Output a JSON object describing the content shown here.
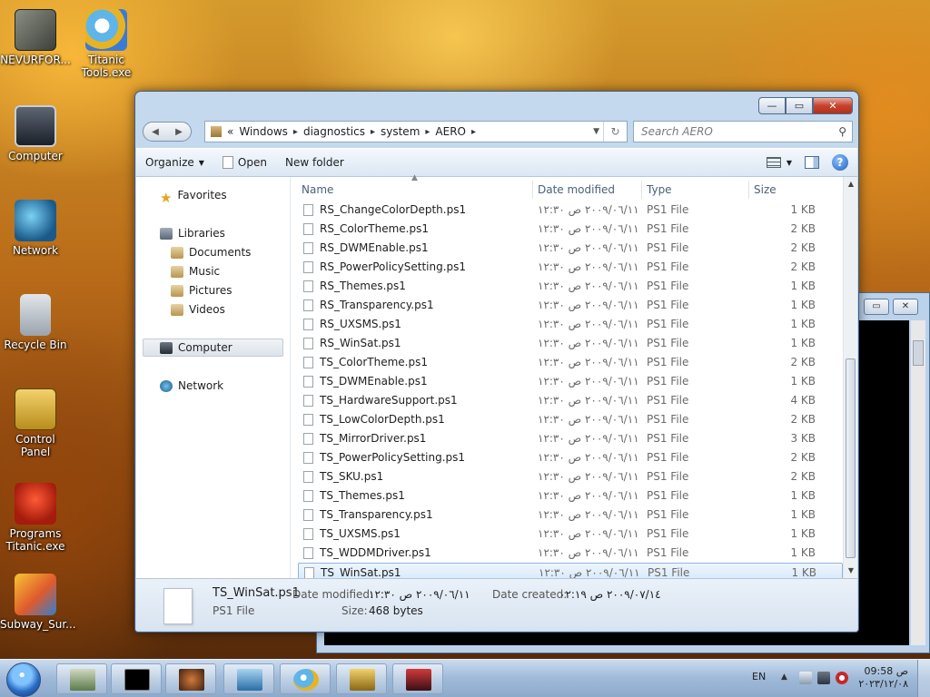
{
  "desktop": {
    "icons": [
      {
        "label": "NEVURFOR...",
        "icon": "nevurfor-icon"
      },
      {
        "label": "Titanic\nTools.exe",
        "icon": "titanic-tools-icon"
      },
      {
        "label": "Computer",
        "icon": "computer-icon"
      },
      {
        "label": "Network",
        "icon": "network-icon"
      },
      {
        "label": "Recycle Bin",
        "icon": "recycle-bin-icon"
      },
      {
        "label": "Control Panel",
        "icon": "control-panel-icon"
      },
      {
        "label": "Programs\nTitanic.exe",
        "icon": "programs-titanic-icon"
      },
      {
        "label": "Subway_Sur...",
        "icon": "subway-surfers-icon"
      }
    ]
  },
  "explorer": {
    "window_buttons": {
      "minimize": "—",
      "maximize": "▭",
      "close": "✕"
    },
    "breadcrumb": {
      "overflow": "«",
      "parts": [
        "Windows",
        "diagnostics",
        "system",
        "AERO"
      ]
    },
    "search": {
      "placeholder": "Search AERO"
    },
    "toolbar": {
      "organize": "Organize",
      "open": "Open",
      "new_folder": "New folder"
    },
    "nav": {
      "favorites": "Favorites",
      "libraries": "Libraries",
      "documents": "Documents",
      "music": "Music",
      "pictures": "Pictures",
      "videos": "Videos",
      "computer": "Computer",
      "network": "Network"
    },
    "columns": {
      "name": "Name",
      "date_modified": "Date modified",
      "type": "Type",
      "size": "Size"
    },
    "files": [
      {
        "name": "RS_ChangeColorDepth.ps1",
        "date": "٢٠٠٩/٠٦/١١ ص ١٢:٣٠",
        "type": "PS1 File",
        "size": "1 KB"
      },
      {
        "name": "RS_ColorTheme.ps1",
        "date": "٢٠٠٩/٠٦/١١ ص ١٢:٣٠",
        "type": "PS1 File",
        "size": "2 KB"
      },
      {
        "name": "RS_DWMEnable.ps1",
        "date": "٢٠٠٩/٠٦/١١ ص ١٢:٣٠",
        "type": "PS1 File",
        "size": "2 KB"
      },
      {
        "name": "RS_PowerPolicySetting.ps1",
        "date": "٢٠٠٩/٠٦/١١ ص ١٢:٣٠",
        "type": "PS1 File",
        "size": "2 KB"
      },
      {
        "name": "RS_Themes.ps1",
        "date": "٢٠٠٩/٠٦/١١ ص ١٢:٣٠",
        "type": "PS1 File",
        "size": "1 KB"
      },
      {
        "name": "RS_Transparency.ps1",
        "date": "٢٠٠٩/٠٦/١١ ص ١٢:٣٠",
        "type": "PS1 File",
        "size": "1 KB"
      },
      {
        "name": "RS_UXSMS.ps1",
        "date": "٢٠٠٩/٠٦/١١ ص ١٢:٣٠",
        "type": "PS1 File",
        "size": "1 KB"
      },
      {
        "name": "RS_WinSat.ps1",
        "date": "٢٠٠٩/٠٦/١١ ص ١٢:٣٠",
        "type": "PS1 File",
        "size": "1 KB"
      },
      {
        "name": "TS_ColorTheme.ps1",
        "date": "٢٠٠٩/٠٦/١١ ص ١٢:٣٠",
        "type": "PS1 File",
        "size": "2 KB"
      },
      {
        "name": "TS_DWMEnable.ps1",
        "date": "٢٠٠٩/٠٦/١١ ص ١٢:٣٠",
        "type": "PS1 File",
        "size": "1 KB"
      },
      {
        "name": "TS_HardwareSupport.ps1",
        "date": "٢٠٠٩/٠٦/١١ ص ١٢:٣٠",
        "type": "PS1 File",
        "size": "4 KB"
      },
      {
        "name": "TS_LowColorDepth.ps1",
        "date": "٢٠٠٩/٠٦/١١ ص ١٢:٣٠",
        "type": "PS1 File",
        "size": "2 KB"
      },
      {
        "name": "TS_MirrorDriver.ps1",
        "date": "٢٠٠٩/٠٦/١١ ص ١٢:٣٠",
        "type": "PS1 File",
        "size": "3 KB"
      },
      {
        "name": "TS_PowerPolicySetting.ps1",
        "date": "٢٠٠٩/٠٦/١١ ص ١٢:٣٠",
        "type": "PS1 File",
        "size": "2 KB"
      },
      {
        "name": "TS_SKU.ps1",
        "date": "٢٠٠٩/٠٦/١١ ص ١٢:٣٠",
        "type": "PS1 File",
        "size": "2 KB"
      },
      {
        "name": "TS_Themes.ps1",
        "date": "٢٠٠٩/٠٦/١١ ص ١٢:٣٠",
        "type": "PS1 File",
        "size": "1 KB"
      },
      {
        "name": "TS_Transparency.ps1",
        "date": "٢٠٠٩/٠٦/١١ ص ١٢:٣٠",
        "type": "PS1 File",
        "size": "1 KB"
      },
      {
        "name": "TS_UXSMS.ps1",
        "date": "٢٠٠٩/٠٦/١١ ص ١٢:٣٠",
        "type": "PS1 File",
        "size": "1 KB"
      },
      {
        "name": "TS_WDDMDriver.ps1",
        "date": "٢٠٠٩/٠٦/١١ ص ١٢:٣٠",
        "type": "PS1 File",
        "size": "1 KB"
      },
      {
        "name": "TS_WinSat.ps1",
        "date": "٢٠٠٩/٠٦/١١ ص ١٢:٣٠",
        "type": "PS1 File",
        "size": "1 KB",
        "selected": true
      }
    ],
    "details": {
      "name": "TS_WinSat.ps1",
      "type": "PS1 File",
      "date_modified_label": "Date modified:",
      "date_modified": "٢٠٠٩/٠٦/١١ ص ١٢:٣٠",
      "date_created_label": "Date created:",
      "date_created": "٢٠٠٩/٠٧/١٤ ص ٠٢:١٩",
      "size_label": "Size:",
      "size": "468 bytes"
    }
  },
  "taskbar": {
    "language": "EN",
    "time": "ص 09:58",
    "date": "٢٠٢٣/١٢/٠٨",
    "buttons": [
      "system-monitor-icon",
      "command-prompt-icon",
      "media-player-icon",
      "photo-viewer-icon",
      "titanic-tools-icon",
      "control-panel-icon",
      "display-icon"
    ]
  },
  "colors": {
    "selection": "#d6e9fb",
    "close_button": "#c7422d",
    "window_frame": "#c4d8ee"
  }
}
